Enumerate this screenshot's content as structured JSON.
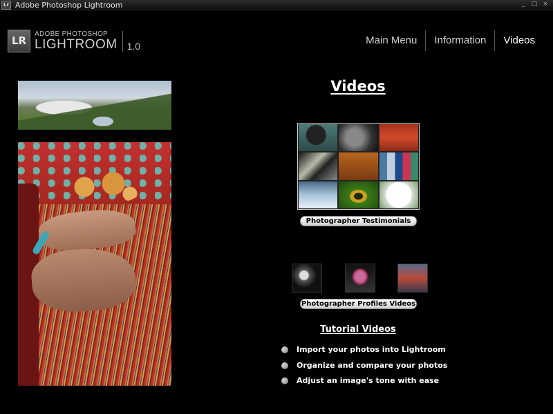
{
  "window": {
    "title": "Adobe Photoshop Lightroom",
    "icon_label": "Lr",
    "controls": [
      "_",
      "□",
      "×"
    ]
  },
  "logo": {
    "mark": "LR",
    "line1": "ADOBE PHOTOSHOP",
    "line2": "LIGHTROOM",
    "version": "1.0"
  },
  "nav": {
    "items": [
      {
        "label": "Main Menu"
      },
      {
        "label": "Information"
      },
      {
        "label": "Videos"
      }
    ],
    "active": "Videos"
  },
  "main": {
    "title": "Videos",
    "testimonials_button": "Photographer Testimonials",
    "profiles_button": "Photographer Profiles Videos",
    "tutorials": {
      "title": "Tutorial Videos",
      "items": [
        {
          "label": "Import your photos into Lightroom"
        },
        {
          "label": "Organize and compare your photos"
        },
        {
          "label": "Adjust an image's tone with ease"
        }
      ]
    }
  }
}
